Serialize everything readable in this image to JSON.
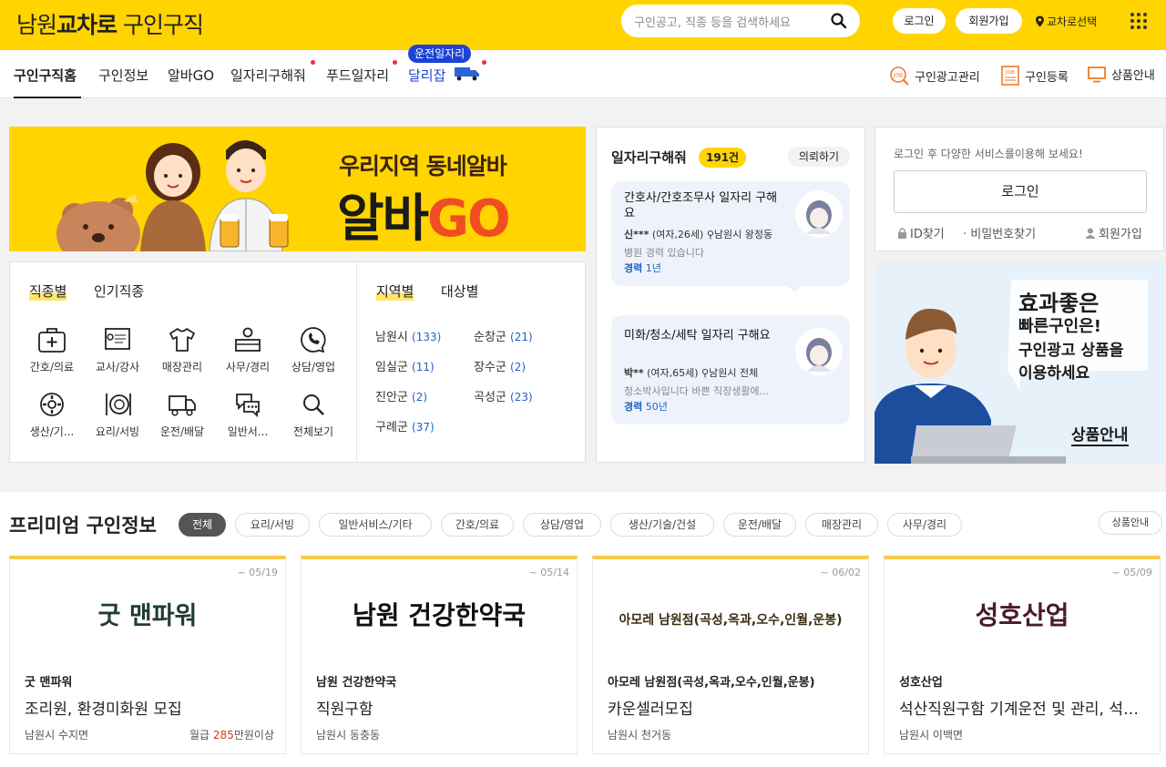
{
  "header": {
    "logo_a": "남원",
    "logo_b": "교차로",
    "logo_c": "구인구직",
    "search_placeholder": "구인공고, 직종 등을 검색하세요",
    "login_label": "로그인",
    "signup_label": "회원가입",
    "region_label": "교차로선택"
  },
  "nav": {
    "items": [
      "구인구직홈",
      "구인정보",
      "알바GO",
      "일자리구해줘",
      "푸드일자리",
      "달리잡"
    ],
    "badge": "운전일자리",
    "right": [
      "구인광고관리",
      "구인등록",
      "상품안내"
    ]
  },
  "banner": {
    "line1": "우리지역 동네알바",
    "line2a": "알바",
    "line2b": "GO"
  },
  "categories": {
    "tab_active": "직종별",
    "tab_other": "인기직종",
    "items": [
      "간호/의료",
      "교사/강사",
      "매장관리",
      "사무/경리",
      "상담/영업",
      "생산/기...",
      "요리/서빙",
      "운전/배달",
      "일반서...",
      "전체보기"
    ]
  },
  "regions": {
    "tab_active": "지역별",
    "tab_other": "대상별",
    "items": [
      {
        "name": "남원시",
        "count": "(133)"
      },
      {
        "name": "순창군",
        "count": "(21)"
      },
      {
        "name": "임실군",
        "count": "(11)"
      },
      {
        "name": "장수군",
        "count": "(2)"
      },
      {
        "name": "진안군",
        "count": "(2)"
      },
      {
        "name": "곡성군",
        "count": "(23)"
      },
      {
        "name": "구례군",
        "count": "(37)"
      }
    ]
  },
  "jobs_wanted": {
    "title": "일자리구해줘",
    "count": "191건",
    "request_label": "의뢰하기",
    "items": [
      {
        "title": "간호사/간호조무사 일자리 구해요",
        "name": "신***",
        "info": "(여자,26세)",
        "loc": "남원시 왕정동",
        "desc": "병원 경력 있습니다",
        "exp_label": "경력",
        "exp": "1년"
      },
      {
        "title": "미화/청소/세탁 일자리 구해요",
        "name": "박**",
        "info": "(여자,65세)",
        "loc": "남원시 전체",
        "desc": "청소박사입니다 바쁜 직장생활에...",
        "exp_label": "경력",
        "exp": "50년"
      }
    ]
  },
  "login_box": {
    "text": "로그인 후 다양한 서비스를이용해 보세요!",
    "button": "로그인",
    "find_id": "ID찾기",
    "find_pw": "비밀번호찾기",
    "signup": "회원가입"
  },
  "promo": {
    "line1": "효과좋은",
    "line2": "빠른구인은!",
    "line3": "구인광고 상품을",
    "line4": "이용하세요",
    "link": "상품안내"
  },
  "premium": {
    "title": "프리미엄 구인정보",
    "product_link": "상품안내",
    "chips": [
      "전체",
      "요리/서빙",
      "일반서비스/기타",
      "간호/의료",
      "상담/영업",
      "생산/기술/건설",
      "운전/배달",
      "매장관리",
      "사무/경리"
    ],
    "cards": [
      {
        "date": "~ 05/19",
        "logo": "굿 맨파워",
        "name": "굿 맨파워",
        "title": "조리원, 환경미화원 모집",
        "loc": "남원시 수지면",
        "salary_label": "월급",
        "salary_value": "285",
        "salary_suffix": "만원이상"
      },
      {
        "date": "~ 05/14",
        "logo": "남원 건강한약국",
        "name": "남원 건강한약국",
        "title": "직원구함",
        "loc": "남원시 동충동"
      },
      {
        "date": "~ 06/02",
        "logo": "아모레 남원점(곡성,옥과,오수,인월,운봉)",
        "name": "아모레 남원점(곡성,옥과,오수,인월,운봉)",
        "title": "카운셀러모집",
        "loc": "남원시 천거동"
      },
      {
        "date": "~ 05/09",
        "logo": "성호산업",
        "name": "성호산업",
        "title": "석산직원구함 기계운전 및 관리, 석산직원",
        "loc": "남원시 이백면"
      }
    ]
  },
  "colors": {
    "brand_yellow": "#ffd400",
    "link_blue": "#1e63c4",
    "badge_blue": "#1c42d6",
    "salary_red": "#d03a17"
  }
}
